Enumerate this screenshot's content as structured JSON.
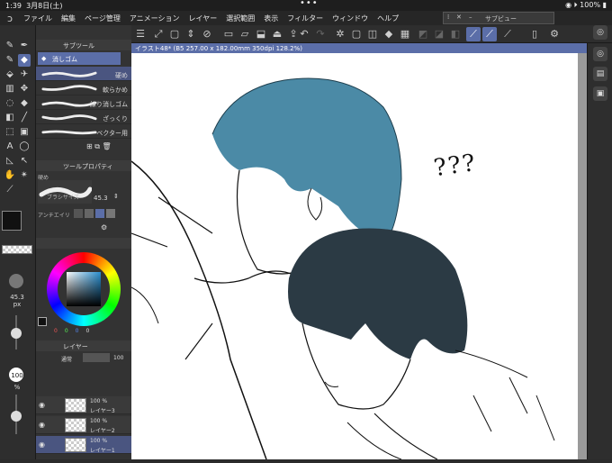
{
  "status": {
    "time": "1:39",
    "date": "3月8日(土)",
    "dots": "•••",
    "battery": "100%"
  },
  "menu": {
    "items": [
      "ファイル",
      "編集",
      "ページ管理",
      "アニメーション",
      "レイヤー",
      "選択範囲",
      "表示",
      "フィルター",
      "ウィンドウ",
      "ヘルプ"
    ]
  },
  "subview": {
    "close": "✕",
    "title": "サブビュー"
  },
  "subtool": {
    "header": "サブツール",
    "selected_group": "消しゴム",
    "brushes": [
      "硬め",
      "軟らかめ",
      "練り消しゴム",
      "ざっくり",
      "ベクター用"
    ]
  },
  "tool_property": {
    "header": "ツールプロパティ",
    "size_label": "ブラシサイズ",
    "size_value": "45.3",
    "antialias_label": "アンチエイリ",
    "hard_label": "硬め"
  },
  "color": {
    "main": "#111111",
    "sub": "#ffffff",
    "values": [
      "0",
      "0",
      "0",
      "0"
    ]
  },
  "left_indicators": {
    "brush_size": "45.3",
    "brush_unit": "px",
    "opacity": "100",
    "opacity_unit": "%"
  },
  "layer": {
    "header": "レイヤー",
    "blend_mode": "通常",
    "opacity": "100",
    "items": [
      {
        "pct": "100 %",
        "name": "レイヤー3"
      },
      {
        "pct": "100 %",
        "name": "レイヤー2"
      },
      {
        "pct": "100 %",
        "name": "レイヤー1"
      }
    ]
  },
  "canvas": {
    "tab_title": "イラスト48* (B5 257.00 x 182.00mm 350dpi 128.2%)",
    "annotation": "???"
  },
  "palette": {
    "hair_blue": "#4b8aa6",
    "hair_dark": "#2b3a44",
    "accent": "#5b6ea8"
  }
}
